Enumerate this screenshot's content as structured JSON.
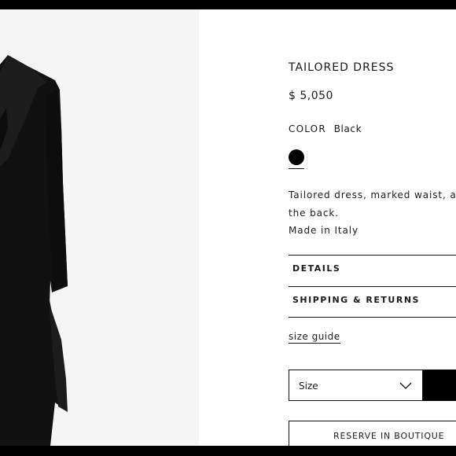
{
  "product": {
    "title": "TAILORED DRESS",
    "price": "$ 5,050",
    "color_label": "COLOR",
    "color_value": "Black",
    "swatch_color": "#000000",
    "description_lines": [
      "Tailored dress, marked waist, asym",
      "the back.",
      "Made in Italy"
    ]
  },
  "accordion": {
    "details": "DETAILS",
    "shipping": "SHIPPING & RETURNS"
  },
  "size_guide": "size guide",
  "size_select": {
    "value": "Size"
  },
  "reserve_button": "RESERVE IN BOUTIQUE",
  "colors": {
    "background": "#ffffff",
    "image_background": "#f5f5f5",
    "garment": "#111111",
    "bars": "#000000"
  }
}
